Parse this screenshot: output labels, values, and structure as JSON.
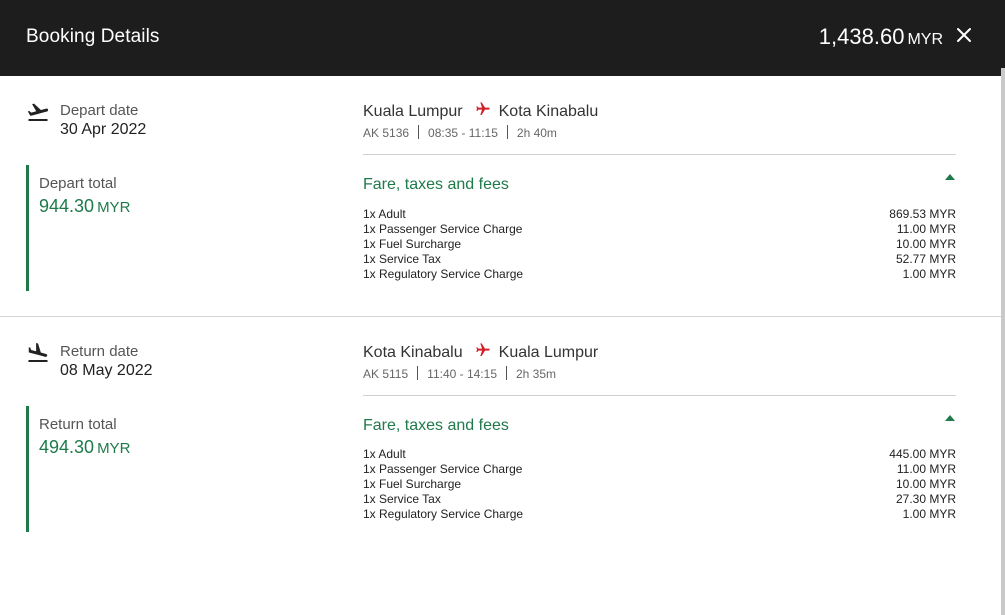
{
  "header": {
    "title": "Booking Details",
    "total_amount": "1,438.60",
    "currency": "MYR",
    "close_icon": "close-icon"
  },
  "colors": {
    "header_bg": "#1d1d1d",
    "accent_green": "#1f7a4a",
    "plane_red": "#d0202a"
  },
  "depart": {
    "date_label": "Depart date",
    "date_value": "30 Apr 2022",
    "total_label": "Depart total",
    "total_amount": "944.30",
    "currency": "MYR",
    "from": "Kuala Lumpur",
    "to": "Kota Kinabalu",
    "flight_no": "AK 5136",
    "time": "08:35 - 11:15",
    "duration": "2h 40m",
    "fare_title": "Fare, taxes and fees",
    "fees": [
      {
        "label": "1x Adult",
        "amount": "869.53 MYR"
      },
      {
        "label": "1x Passenger Service Charge",
        "amount": "11.00 MYR"
      },
      {
        "label": "1x Fuel Surcharge",
        "amount": "10.00 MYR"
      },
      {
        "label": "1x Service Tax",
        "amount": "52.77 MYR"
      },
      {
        "label": "1x Regulatory Service Charge",
        "amount": "1.00 MYR"
      }
    ]
  },
  "return": {
    "date_label": "Return date",
    "date_value": "08 May 2022",
    "total_label": "Return total",
    "total_amount": "494.30",
    "currency": "MYR",
    "from": "Kota Kinabalu",
    "to": "Kuala Lumpur",
    "flight_no": "AK 5115",
    "time": "11:40 - 14:15",
    "duration": "2h 35m",
    "fare_title": "Fare, taxes and fees",
    "fees": [
      {
        "label": "1x Adult",
        "amount": "445.00 MYR"
      },
      {
        "label": "1x Passenger Service Charge",
        "amount": "11.00 MYR"
      },
      {
        "label": "1x Fuel Surcharge",
        "amount": "10.00 MYR"
      },
      {
        "label": "1x Service Tax",
        "amount": "27.30 MYR"
      },
      {
        "label": "1x Regulatory Service Charge",
        "amount": "1.00 MYR"
      }
    ]
  }
}
